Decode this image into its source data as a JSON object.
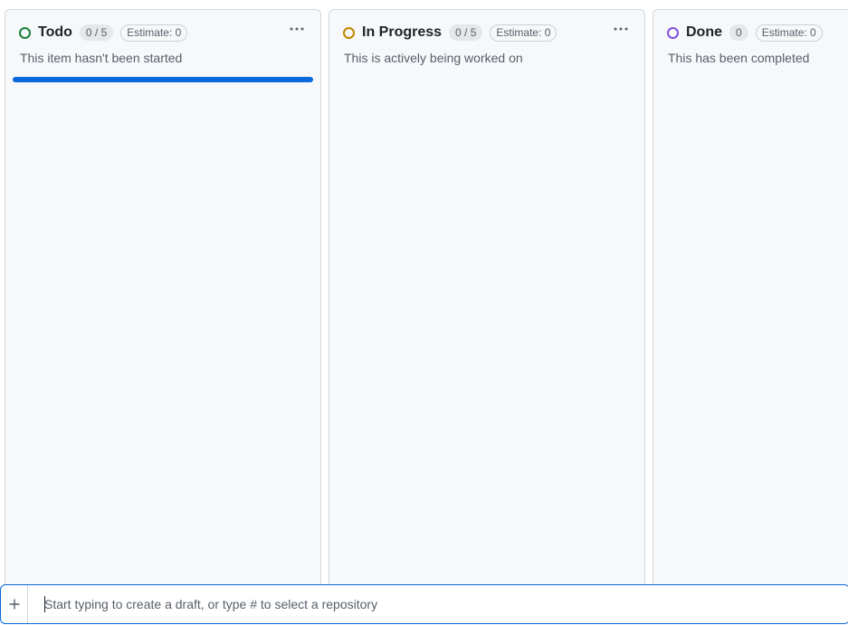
{
  "columns": [
    {
      "title": "Todo",
      "count": "0 / 5",
      "estimate": "Estimate: 0",
      "description": "This item hasn't been started",
      "status_color": "#1a7f37",
      "menu_icon": "kebab-horizontal-icon"
    },
    {
      "title": "In Progress",
      "count": "0 / 5",
      "estimate": "Estimate: 0",
      "description": "This is actively being worked on",
      "status_color": "#bf8700",
      "menu_icon": "kebab-horizontal-icon"
    },
    {
      "title": "Done",
      "count": "0",
      "estimate": "Estimate: 0",
      "description": "This has been completed",
      "status_color": "#8250df"
    }
  ],
  "add_item": {
    "icon": "plus-icon",
    "placeholder": "Start typing to create a draft, or type # to select a repository"
  },
  "colors": {
    "accent": "#0969da",
    "column_bg": "#f6f8fa",
    "border": "#d0d7de"
  }
}
